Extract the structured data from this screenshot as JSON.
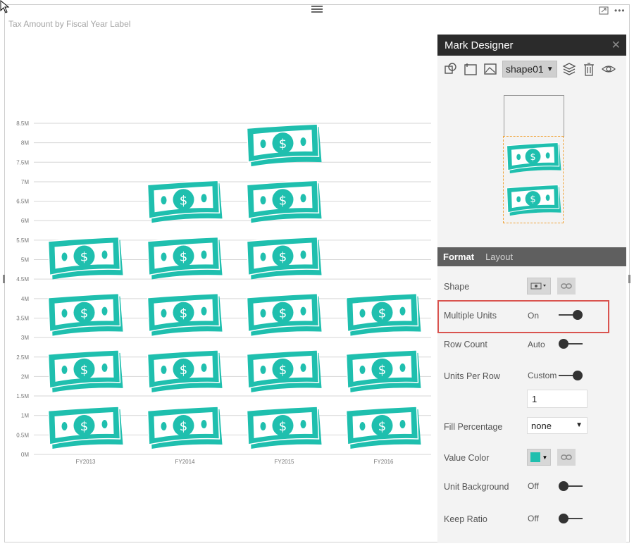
{
  "visual": {
    "title": "Tax Amount by Fiscal Year Label",
    "header_icons": [
      "focus-mode-icon",
      "more-options-icon"
    ]
  },
  "chart_data": {
    "type": "bar",
    "title": "Tax Amount by Fiscal Year Label",
    "categories": [
      "FY2013",
      "FY2014",
      "FY2015",
      "FY2016"
    ],
    "values": [
      5500000,
      7100000,
      8400000,
      4300000
    ],
    "unit_value": 1450000,
    "ylim": [
      0,
      8500000
    ],
    "y_ticks": [
      "0M",
      "0.5M",
      "1M",
      "1.5M",
      "2M",
      "2.5M",
      "3M",
      "3.5M",
      "4M",
      "4.5M",
      "5M",
      "5.5M",
      "6M",
      "6.5M",
      "7M",
      "7.5M",
      "8M",
      "8.5M"
    ],
    "grid": true,
    "mark": "money-bill-icon",
    "mark_color": "#1fbfae"
  },
  "mark_designer": {
    "title": "Mark Designer",
    "shape_name": "shape01",
    "toolbar_icons": [
      "shapes-icon",
      "text-icon",
      "image-icon",
      "layers-icon",
      "delete-icon",
      "visibility-icon"
    ],
    "tabs": [
      "Format",
      "Layout"
    ],
    "active_tab": "Format",
    "properties": {
      "shape": {
        "label": "Shape"
      },
      "multiple_units": {
        "label": "Multiple Units",
        "value": "On",
        "on": true
      },
      "row_count": {
        "label": "Row Count",
        "value": "Auto",
        "on": false
      },
      "units_per_row": {
        "label": "Units Per Row",
        "value": "Custom",
        "on": true,
        "input": "1"
      },
      "fill_percentage": {
        "label": "Fill Percentage",
        "value": "none"
      },
      "value_color": {
        "label": "Value Color",
        "color": "#1fbfae"
      },
      "unit_background": {
        "label": "Unit Background",
        "value": "Off",
        "on": false
      },
      "keep_ratio": {
        "label": "Keep Ratio",
        "value": "Off",
        "on": false
      }
    },
    "highlight_color": "#d9534f"
  }
}
